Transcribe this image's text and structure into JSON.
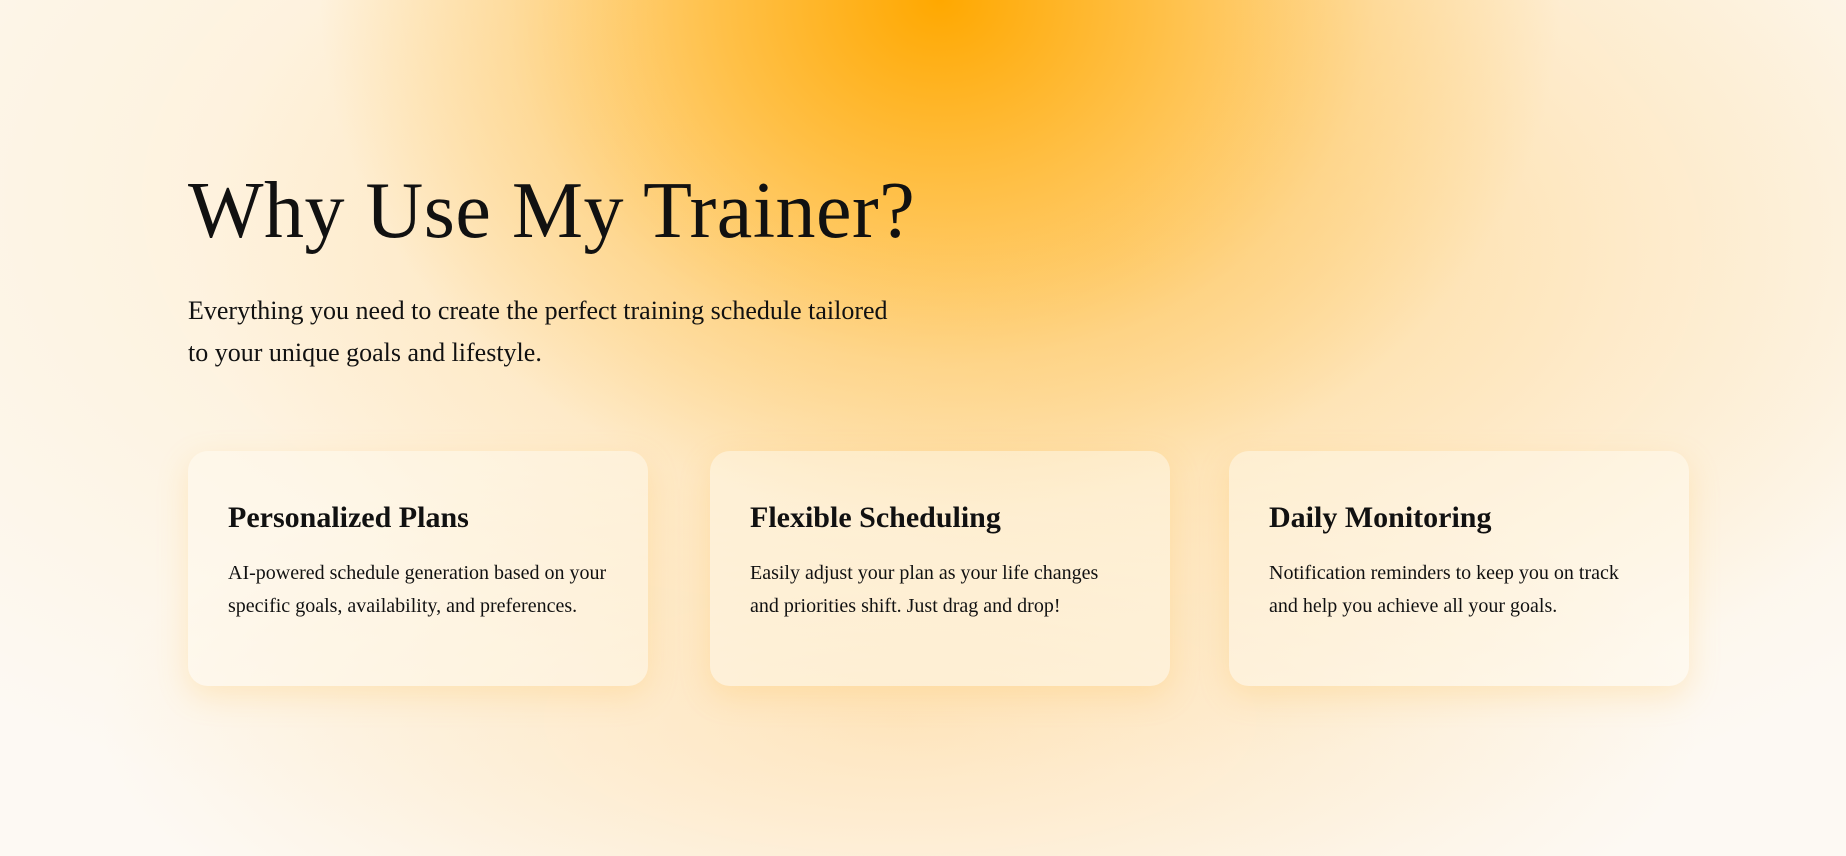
{
  "hero": {
    "title": "Why Use My Trainer?",
    "subtitle": "Everything you need to create the perfect training schedule tailored to your unique goals and lifestyle."
  },
  "features": [
    {
      "title": "Personalized Plans",
      "description": "AI-powered schedule generation based on your specific goals, availability, and preferences."
    },
    {
      "title": "Flexible Scheduling",
      "description": "Easily adjust your plan as your life changes and priorities shift. Just drag and drop!"
    },
    {
      "title": "Daily Monitoring",
      "description": "Notification reminders to keep you on track and help you achieve all your goals."
    }
  ],
  "colors": {
    "accent": "#FFAA00",
    "background": "#FDF9F3"
  }
}
